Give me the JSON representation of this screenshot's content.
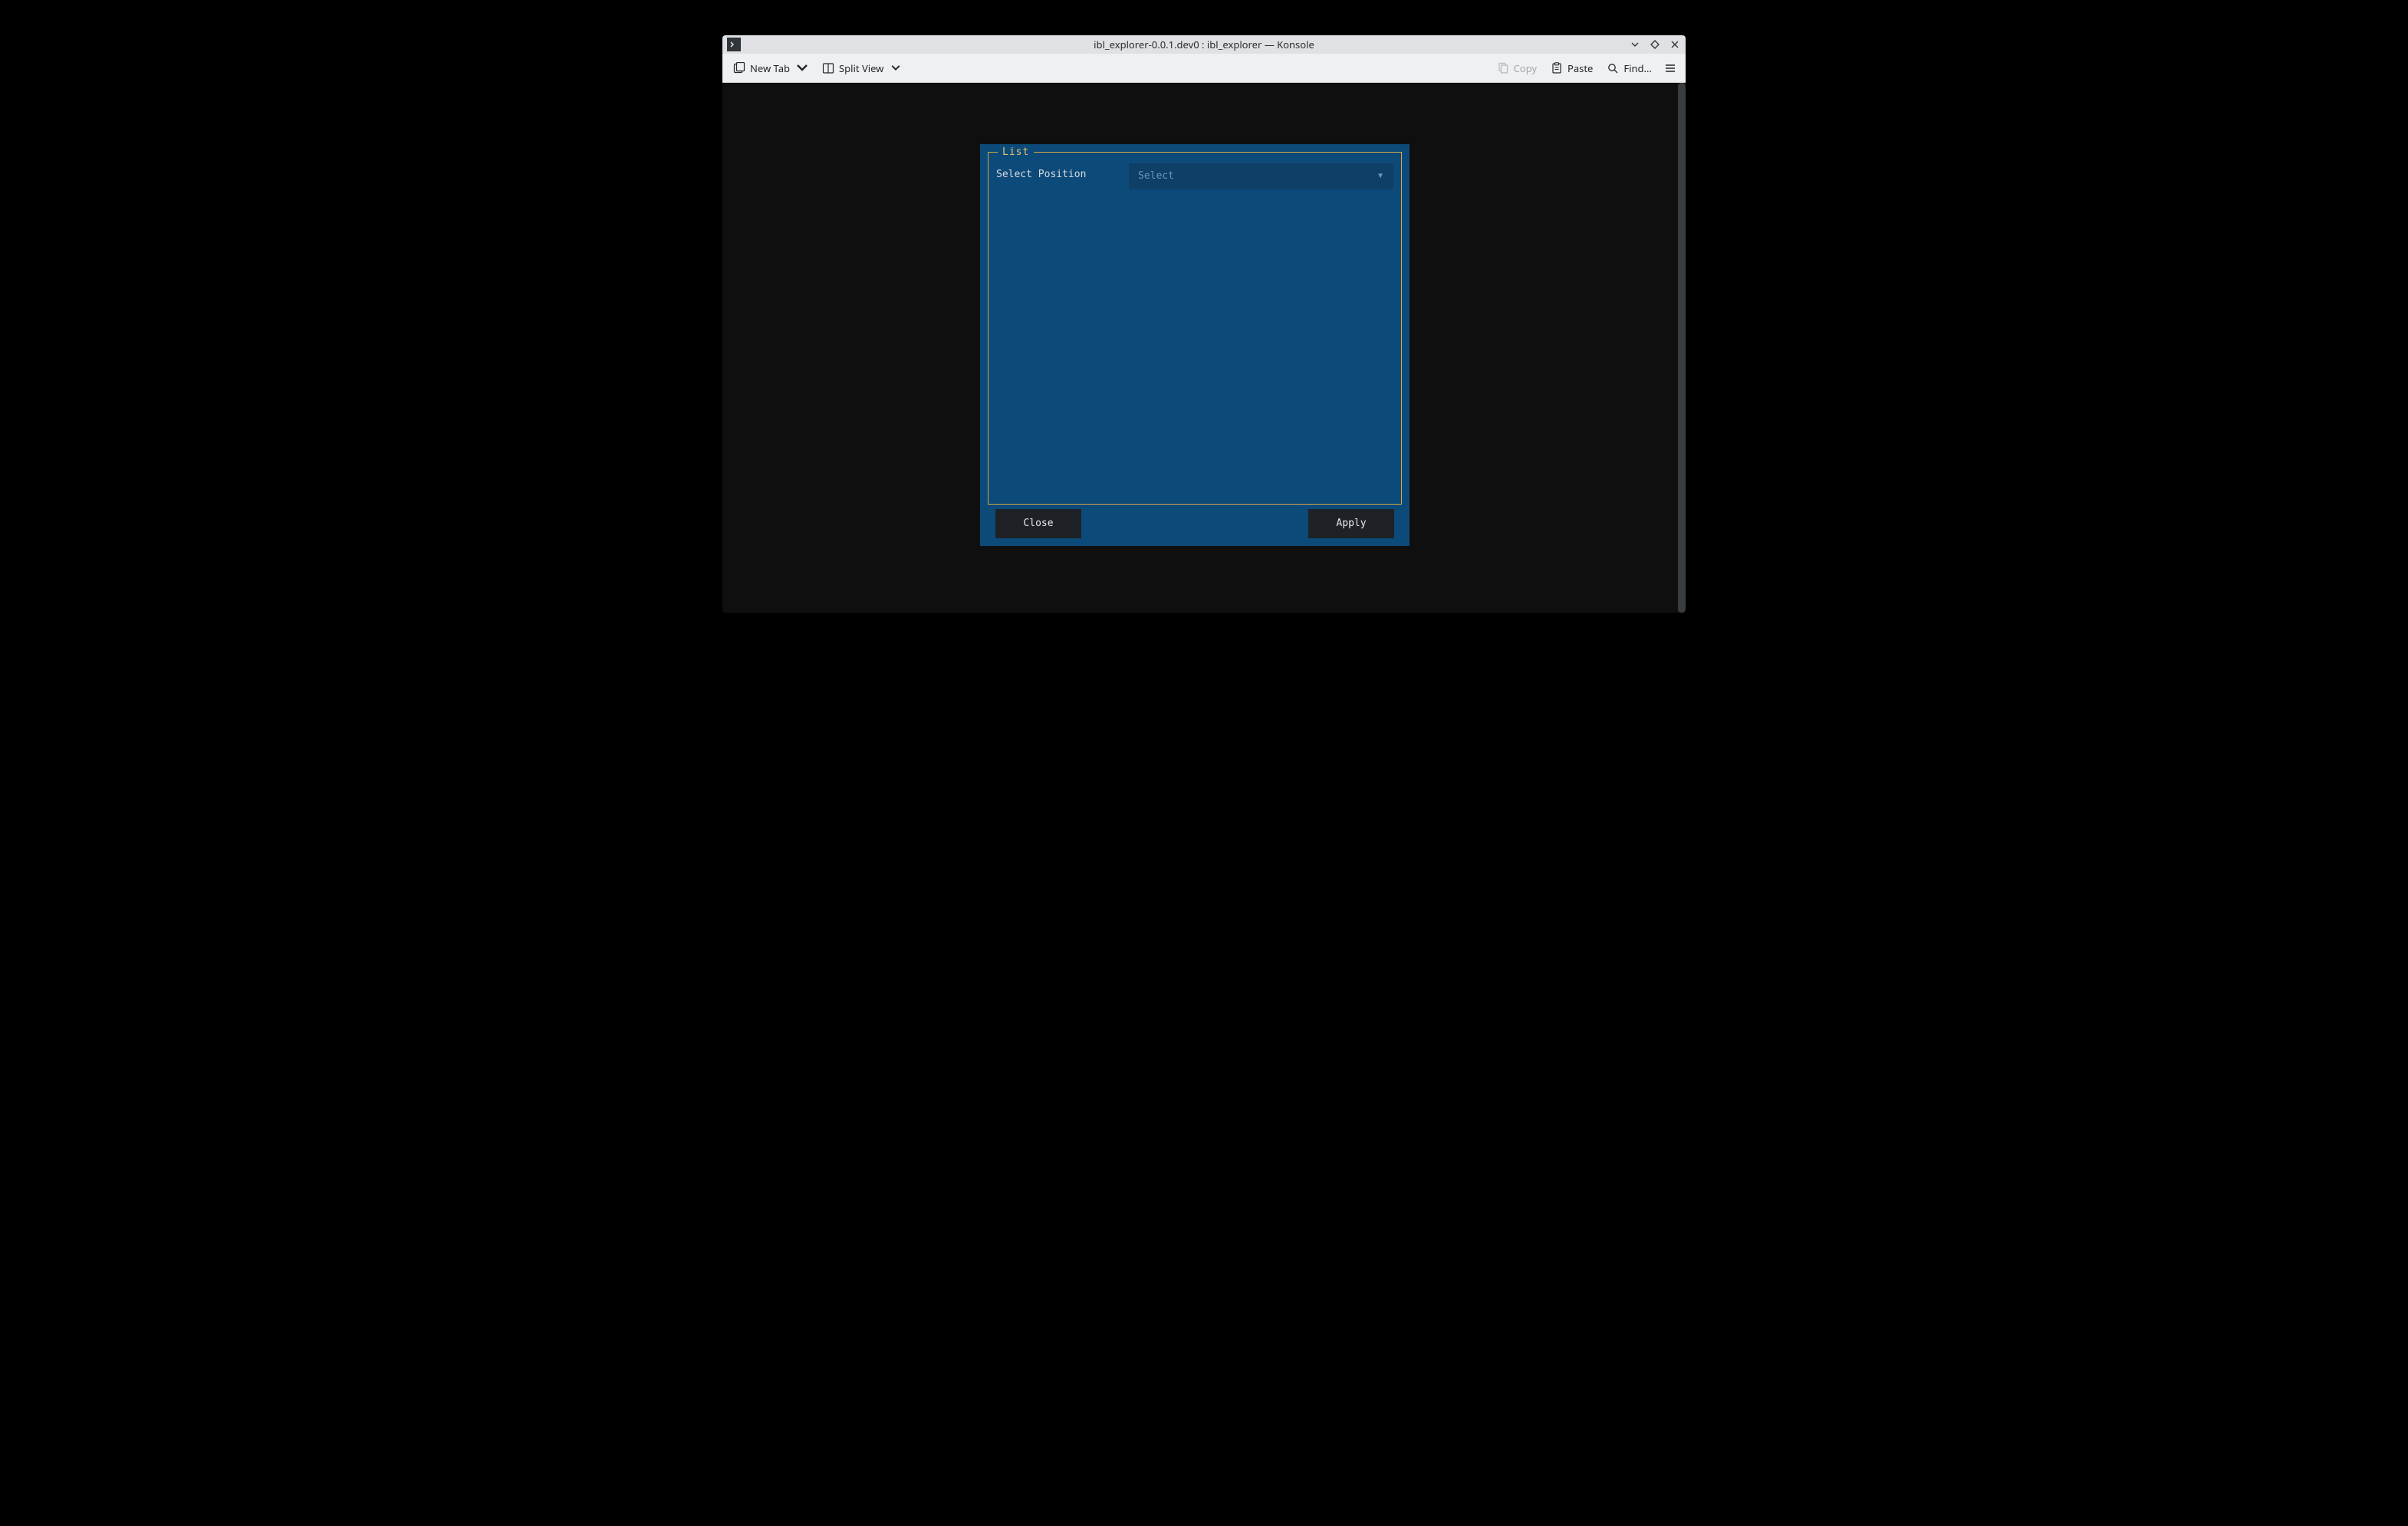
{
  "window": {
    "title": "ibl_explorer-0.0.1.dev0 : ibl_explorer — Konsole"
  },
  "toolbar": {
    "new_tab": "New Tab",
    "split_view": "Split View",
    "copy": "Copy",
    "paste": "Paste",
    "find": "Find..."
  },
  "tui": {
    "legend": "List",
    "select_position_label": "Select Position",
    "select_placeholder": "Select",
    "close": "Close",
    "apply": "Apply"
  }
}
